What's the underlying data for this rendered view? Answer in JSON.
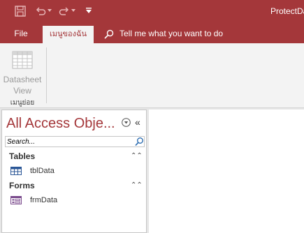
{
  "window": {
    "title": "ProtectDa"
  },
  "tabs": {
    "file": "File",
    "active": "เมนูของฉัน",
    "tell_me": "Tell me what you want to do"
  },
  "ribbon": {
    "datasheet_line1": "Datasheet",
    "datasheet_line2": "View",
    "group_label": "เมนูย่อย"
  },
  "nav_pane": {
    "title": "All Access Obje...",
    "search_placeholder": "Search...",
    "groups": [
      {
        "label": "Tables",
        "items": [
          {
            "label": "tblData",
            "icon": "table-icon"
          }
        ]
      },
      {
        "label": "Forms",
        "items": [
          {
            "label": "frmData",
            "icon": "form-icon"
          }
        ]
      }
    ]
  },
  "colors": {
    "accent": "#a4373a",
    "ribbon_bg": "#f3f3f3",
    "workspace_bg": "#e6e6e6"
  }
}
